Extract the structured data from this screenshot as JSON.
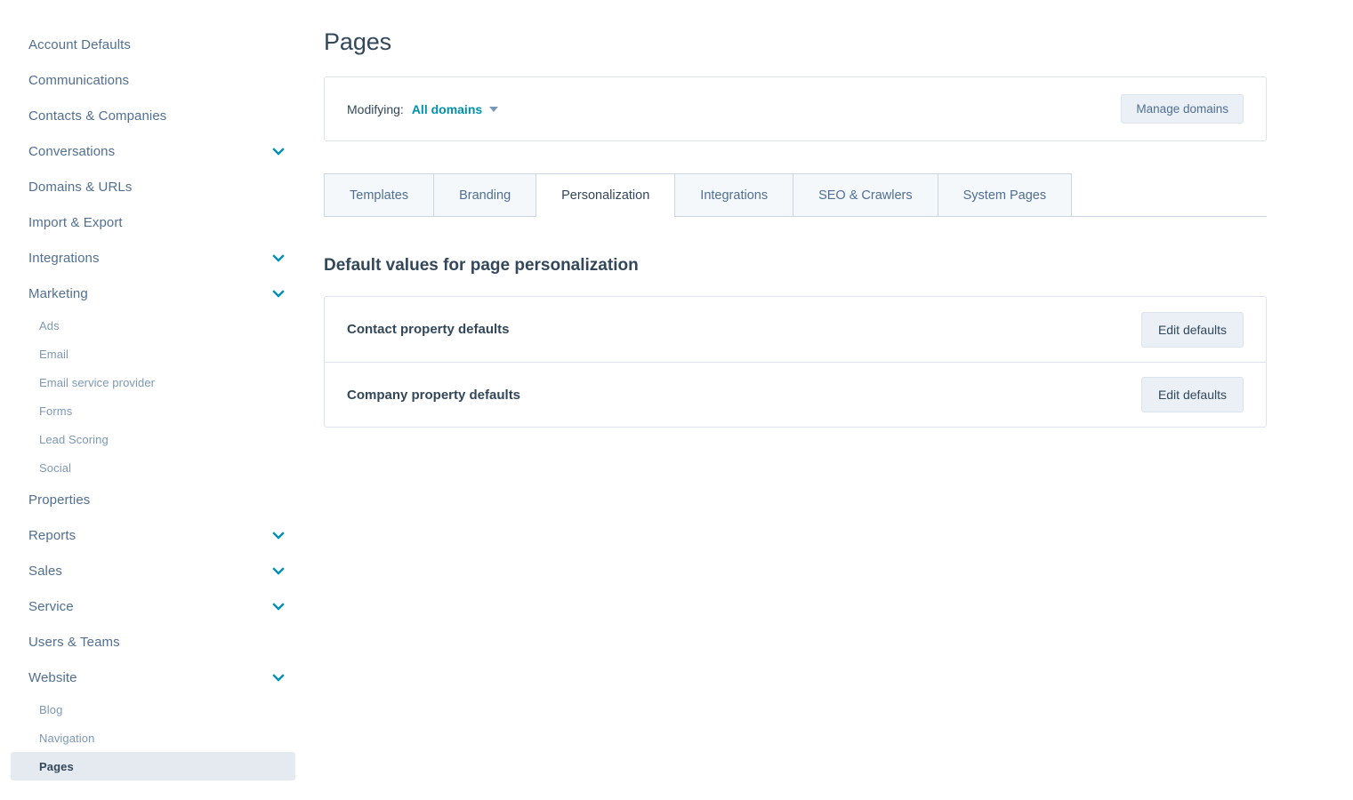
{
  "sidebar": {
    "items": [
      {
        "label": "Account Defaults",
        "level": "top",
        "chevron": false,
        "selected": false
      },
      {
        "label": "Communications",
        "level": "top",
        "chevron": false,
        "selected": false
      },
      {
        "label": "Contacts & Companies",
        "level": "top",
        "chevron": false,
        "selected": false
      },
      {
        "label": "Conversations",
        "level": "top",
        "chevron": true,
        "selected": false
      },
      {
        "label": "Domains & URLs",
        "level": "top",
        "chevron": false,
        "selected": false
      },
      {
        "label": "Import & Export",
        "level": "top",
        "chevron": false,
        "selected": false
      },
      {
        "label": "Integrations",
        "level": "top",
        "chevron": true,
        "selected": false
      },
      {
        "label": "Marketing",
        "level": "top",
        "chevron": true,
        "selected": false
      },
      {
        "label": "Ads",
        "level": "sub",
        "chevron": false,
        "selected": false
      },
      {
        "label": "Email",
        "level": "sub",
        "chevron": false,
        "selected": false
      },
      {
        "label": "Email service provider",
        "level": "sub",
        "chevron": false,
        "selected": false
      },
      {
        "label": "Forms",
        "level": "sub",
        "chevron": false,
        "selected": false
      },
      {
        "label": "Lead Scoring",
        "level": "sub",
        "chevron": false,
        "selected": false
      },
      {
        "label": "Social",
        "level": "sub",
        "chevron": false,
        "selected": false
      },
      {
        "label": "Properties",
        "level": "top",
        "chevron": false,
        "selected": false
      },
      {
        "label": "Reports",
        "level": "top",
        "chevron": true,
        "selected": false
      },
      {
        "label": "Sales",
        "level": "top",
        "chevron": true,
        "selected": false
      },
      {
        "label": "Service",
        "level": "top",
        "chevron": true,
        "selected": false
      },
      {
        "label": "Users & Teams",
        "level": "top",
        "chevron": false,
        "selected": false
      },
      {
        "label": "Website",
        "level": "top",
        "chevron": true,
        "selected": false
      },
      {
        "label": "Blog",
        "level": "sub",
        "chevron": false,
        "selected": false
      },
      {
        "label": "Navigation",
        "level": "sub",
        "chevron": false,
        "selected": false
      },
      {
        "label": "Pages",
        "level": "sub",
        "chevron": false,
        "selected": true
      }
    ]
  },
  "main": {
    "page_title": "Pages",
    "domain_bar": {
      "modifying_label": "Modifying:",
      "selected_domain": "All domains",
      "manage_domains_label": "Manage domains"
    },
    "tabs": [
      {
        "label": "Templates",
        "active": false
      },
      {
        "label": "Branding",
        "active": false
      },
      {
        "label": "Personalization",
        "active": true
      },
      {
        "label": "Integrations",
        "active": false
      },
      {
        "label": "SEO & Crawlers",
        "active": false
      },
      {
        "label": "System Pages",
        "active": false
      }
    ],
    "section": {
      "title": "Default values for page personalization",
      "rows": [
        {
          "label": "Contact property defaults",
          "button": "Edit defaults"
        },
        {
          "label": "Company property defaults",
          "button": "Edit defaults"
        }
      ]
    }
  },
  "colors": {
    "accent_teal": "#0091ae",
    "text_navy": "#33475b",
    "text_muted": "#516f90",
    "border": "#dfe3eb",
    "button_bg": "#eaf0f6",
    "selected_bg": "#e5eaf0"
  }
}
